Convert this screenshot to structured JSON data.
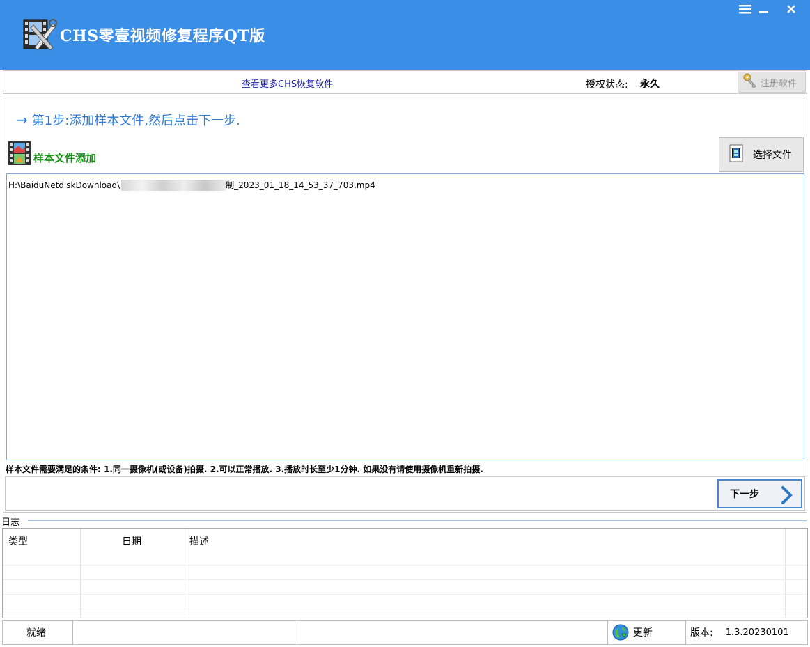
{
  "window": {
    "title": "CHS零壹视频修复程序QT版",
    "accent_color": "#3b8ee6"
  },
  "topbar": {
    "more_link": "查看更多CHS恢复软件",
    "auth_label": "授权状态:",
    "auth_value": "永久",
    "register_label": "注册软件"
  },
  "step": {
    "arrow": "→",
    "title": "第1步:添加样本文件,然后点击下一步."
  },
  "sample": {
    "label": "样本文件添加",
    "choose_label": "选择文件",
    "files": [
      {
        "path_prefix": "H:\\BaiduNetdiskDownload\\",
        "path_suffix": "制_2023_01_18_14_53_37_703.mp4"
      }
    ],
    "conditions": "样本文件需要满足的条件: 1.同一摄像机(或设备)拍摄.  2.可以正常播放.  3.播放时长至少1分钟.  如果没有请使用摄像机重新拍摄."
  },
  "nav": {
    "next_label": "下一步"
  },
  "log": {
    "legend": "日志",
    "columns": [
      "类型",
      "日期",
      "描述"
    ]
  },
  "statusbar": {
    "status": "就绪",
    "update_label": "更新",
    "version_label": "版本:",
    "version_value": "1.3.20230101"
  },
  "icons": {
    "logo": "film-tools-icon",
    "menu": "menu-icon",
    "minimize": "minimize-icon",
    "close": "close-icon",
    "register": "keys-icon",
    "sample": "film-strip-icon",
    "choose": "film-file-icon",
    "next": "chevron-right-icon",
    "update": "globe-update-icon"
  }
}
